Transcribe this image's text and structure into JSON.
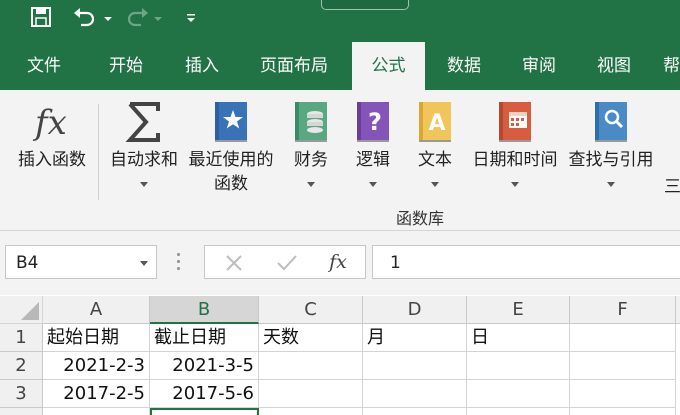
{
  "tabs": [
    "文件",
    "开始",
    "插入",
    "页面布局",
    "公式",
    "数据",
    "审阅",
    "视图",
    "帮"
  ],
  "active_tab": 4,
  "ribbon": {
    "buttons": [
      {
        "label": "插入函数",
        "label2": "",
        "icon": "fx-icon"
      },
      {
        "label": "自动求和",
        "label2": "",
        "icon": "sigma-icon"
      },
      {
        "label": "最近使用的",
        "label2": "函数",
        "icon": "star-book-icon"
      },
      {
        "label": "财务",
        "label2": "",
        "icon": "finance-book-icon"
      },
      {
        "label": "逻辑",
        "label2": "",
        "icon": "logic-book-icon"
      },
      {
        "label": "文本",
        "label2": "",
        "icon": "text-book-icon"
      },
      {
        "label": "日期和时间",
        "label2": "",
        "icon": "calendar-book-icon"
      },
      {
        "label": "查找与引用",
        "label2": "",
        "icon": "lookup-book-icon"
      }
    ],
    "group_label": "函数库",
    "edge_text": "三"
  },
  "formula_bar": {
    "name_box": "B4",
    "formula_value": "1",
    "fx_label": "fx"
  },
  "grid": {
    "columns": [
      "A",
      "B",
      "C",
      "D",
      "E",
      "F"
    ],
    "rows": [
      "1",
      "2",
      "3"
    ],
    "cells": [
      [
        "起始日期",
        "截止日期",
        "天数",
        "月",
        "日",
        ""
      ],
      [
        "2021-2-3",
        "2021-3-5",
        "",
        "",
        "",
        ""
      ],
      [
        "2017-2-5",
        "2017-5-6",
        "",
        "",
        "",
        ""
      ]
    ],
    "selected_column": "B"
  },
  "colors": {
    "brand": "#217346",
    "ribbon_bg": "#f3f3f3"
  }
}
